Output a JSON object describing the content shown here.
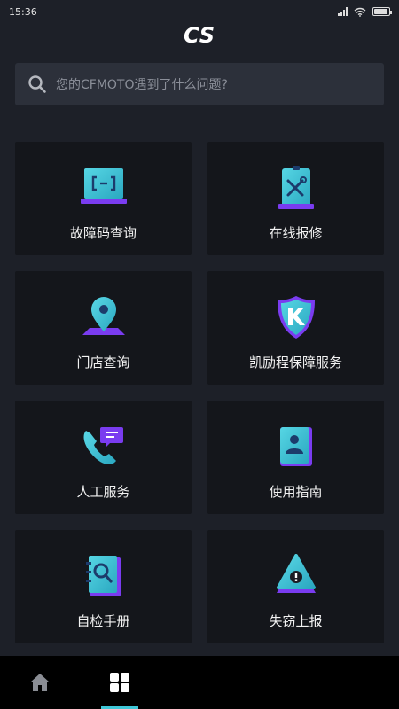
{
  "status": {
    "time": "15:36"
  },
  "header": {
    "logo": "CS"
  },
  "search": {
    "placeholder": "您的CFMOTO遇到了什么问题?"
  },
  "cards": [
    {
      "label": "故障码查询",
      "icon": "fault-code-monitor-icon"
    },
    {
      "label": "在线报修",
      "icon": "repair-tools-icon"
    },
    {
      "label": "门店查询",
      "icon": "location-pin-icon"
    },
    {
      "label": "凯励程保障服务",
      "icon": "shield-k-icon"
    },
    {
      "label": "人工服务",
      "icon": "phone-chat-icon"
    },
    {
      "label": "使用指南",
      "icon": "user-guide-book-icon"
    },
    {
      "label": "自检手册",
      "icon": "self-check-manual-icon"
    },
    {
      "label": "失窃上报",
      "icon": "theft-warning-icon"
    }
  ],
  "tabbar": {
    "tabs": [
      "home",
      "services",
      "tab-3",
      "tab-4",
      "tab-5"
    ],
    "active": 1
  },
  "colors": {
    "accent": "#3fc7d8",
    "accent2": "#7a3cf0",
    "background": "#1d2028",
    "card": "#14161b"
  }
}
